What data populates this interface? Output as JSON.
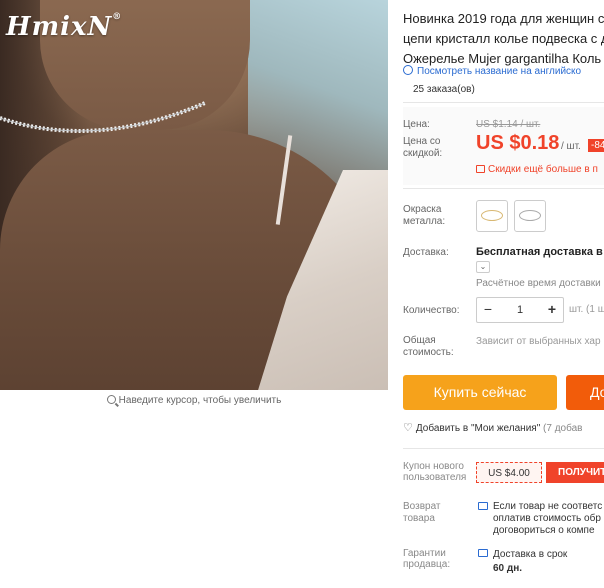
{
  "image": {
    "logo_text": "HmixN",
    "logo_mark": "®",
    "zoom_hint": "Наведите курсор, чтобы увеличить"
  },
  "product": {
    "title_lines": [
      "Новинка 2019 года для женщин с",
      "цепи кристалл колье подвеска с д",
      "Ожерелье Mujer gargantilha Коль"
    ],
    "translate_link": "Посмотреть название на английско",
    "orders": "25 заказа(ов)"
  },
  "price": {
    "old_label": "Цена:",
    "old_value": "US $1.14 / шт.",
    "new_label": "Цена со скидкой:",
    "new_value": "US $0.18",
    "per_unit": "/ шт.",
    "discount_badge": "-84",
    "promo_text": "Скидки ещё больше в п"
  },
  "options": {
    "color_label": "Окраска металла:",
    "swatches": [
      "gold-choker-swatch",
      "silver-choker-swatch"
    ],
    "shipping_label": "Доставка:",
    "shipping_value": "Бесплатная доставка в R",
    "shipping_time": "Расчётное время доставки",
    "quantity_label": "Количество:",
    "quantity_value": "1",
    "quantity_minus": "−",
    "quantity_plus": "+",
    "quantity_unit": "шт. (1 ш",
    "total_label": "Общая стоимость:",
    "total_value": "Зависит от выбранных хар"
  },
  "actions": {
    "buy_now": "Купить сейчас",
    "add_to_cart": "До",
    "wishlist": "Добавить в \"Мои желания\"",
    "wishlist_count": "(7 добав"
  },
  "coupon": {
    "label": "Купон нового пользователя",
    "amount": "US $4.00",
    "get": "ПОЛУЧИТ"
  },
  "returns": {
    "label": "Возврат товара",
    "lines": [
      "Если товар не соответс",
      "оплатив стоимость обр",
      "договориться о компе"
    ]
  },
  "guarantee": {
    "label": "Гарантии продавца:",
    "line1": "Доставка в срок",
    "line2": "60 дн."
  },
  "colors": {
    "accent_red": "#f0432a",
    "buy_orange": "#f6a21b",
    "cart_orange": "#f25c0a",
    "link_blue": "#2a6bd1"
  }
}
